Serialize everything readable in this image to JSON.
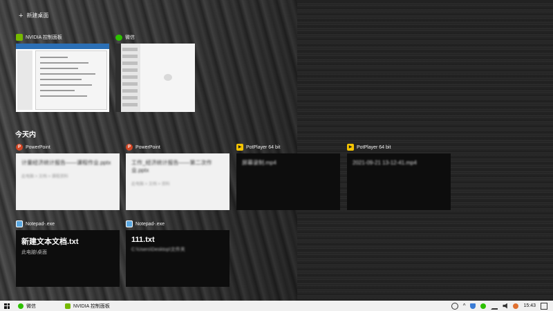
{
  "new_desktop_label": "新建桌面",
  "windows": [
    {
      "title": "NVIDIA 控制面板",
      "icon": "nvidia-icon"
    },
    {
      "title": "微信",
      "icon": "wechat-icon"
    }
  ],
  "section_title": "今天内",
  "timeline": [
    {
      "app": "PowerPoint",
      "icon": "powerpoint-icon",
      "theme": "light",
      "blurred_title": "计量经济统计报告——课程作业.pptx",
      "blurred_sub": "此电脑 > 文档 > 课程资料"
    },
    {
      "app": "PowerPoint",
      "icon": "powerpoint-icon",
      "theme": "light",
      "blurred_title": "工作_经济统计报告——第二次作业.pptx",
      "blurred_sub": "此电脑 > 文档 > 资料"
    },
    {
      "app": "PotPlayer 64 bit",
      "icon": "potplayer-icon",
      "theme": "dark",
      "blurred_title": "屏幕录制.mp4",
      "blurred_sub": ""
    },
    {
      "app": "PotPlayer 64 bit",
      "icon": "potplayer-icon",
      "theme": "dark",
      "blurred_title": "2021-09-21 13-12-41.mp4",
      "blurred_sub": ""
    },
    {
      "app": "Notepad-.exe",
      "icon": "notepad-icon",
      "theme": "dark",
      "file": "新建文本文档.txt",
      "path": "此电脑\\桌面"
    },
    {
      "app": "Notepad-.exe",
      "icon": "notepad-icon",
      "theme": "dark",
      "file": "111.txt",
      "blurred_path": "C:\\Users\\Desktop\\文件夹"
    }
  ],
  "taskbar": {
    "items": [
      {
        "label": "微信",
        "icon": "wechat-icon"
      },
      {
        "label": "NVIDIA 控制面板",
        "icon": "nvidia-icon"
      }
    ],
    "clock": "15:43"
  }
}
